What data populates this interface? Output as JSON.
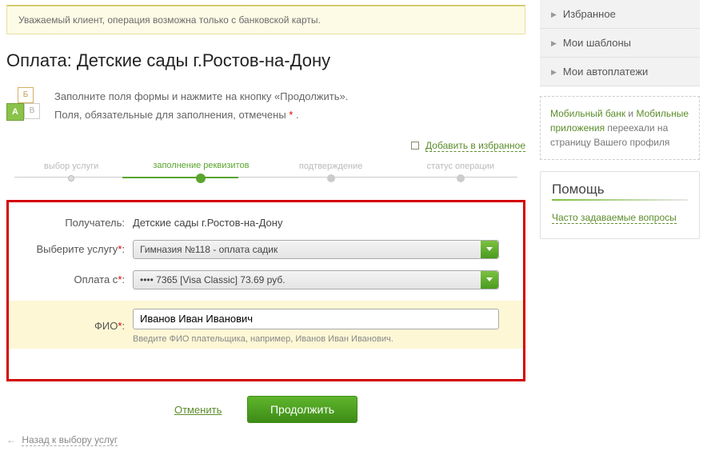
{
  "alert": "Уважаемый клиент, операция возможна только с банковской карты.",
  "title": "Оплата: Детские сады г.Ростов-на-Дону",
  "info": {
    "line1": "Заполните поля формы и нажмите на кнопку «Продолжить».",
    "line2_a": "Поля, обязательные для заполнения, отмечены ",
    "line2_b": " ."
  },
  "fav": "Добавить в избранное",
  "steps": {
    "s1": "выбор услуги",
    "s2": "заполнение реквизитов",
    "s3": "подтверждение",
    "s4": "статус операции"
  },
  "form": {
    "recipient_label": "Получатель:",
    "recipient_value": "Детские сады г.Ростов-на-Дону",
    "service_label": "Выберите услугу",
    "service_value": "Гимназия №118 - оплата садик",
    "payfrom_label": "Оплата с",
    "payfrom_value": "•••• 7365 [Visa Classic] 73.69 руб.",
    "fio_label": "ФИО",
    "fio_value": "Иванов Иван Иванович",
    "fio_hint": "Введите ФИО плательщика, например, Иванов Иван Иванович."
  },
  "actions": {
    "cancel": "Отменить",
    "continue": "Продолжить"
  },
  "back": "Назад к выбору услуг",
  "sidebar": {
    "items": [
      "Избранное",
      "Мои шаблоны",
      "Мои автоплатежи"
    ],
    "note": {
      "a1": "Мобильный банк",
      "t1": " и ",
      "a2": "Мобильные приложения",
      "t2": " переехали на страницу Вашего профиля"
    },
    "help_title": "Помощь",
    "faq": "Часто задаваемые вопросы"
  }
}
